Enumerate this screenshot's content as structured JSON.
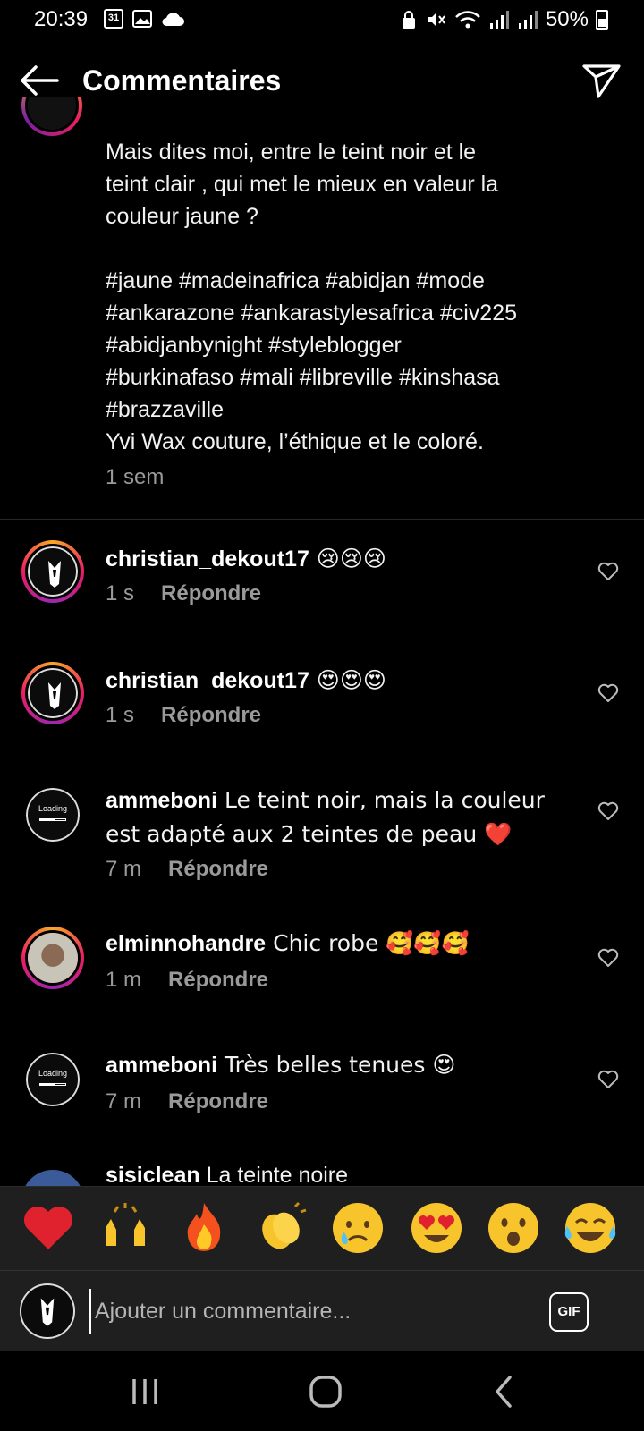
{
  "status_bar": {
    "time": "20:39",
    "calendar_day": "31",
    "battery": "50%",
    "battery_level": 0.5
  },
  "header": {
    "title": "Commentaires"
  },
  "caption": {
    "lines": [
      "Mais dites moi, entre le teint noir et le",
      "teint clair , qui met le mieux en valeur la",
      "couleur jaune ?",
      "",
      "#jaune #madeinafrica #abidjan #mode",
      "#ankarazone #ankarastylesafrica #civ225",
      "#abidjanbynight #styleblogger",
      "#burkinafaso #mali #libreville #kinshasa",
      "#brazzaville",
      "Yvi Wax couture, l’éthique et le coloré."
    ],
    "time": "1 sem"
  },
  "comments": [
    {
      "username": "christian_dekout17",
      "text": " 😢😢😢",
      "time": "1 s",
      "reply": "Répondre"
    },
    {
      "username": "christian_dekout17",
      "text": " 😍😍😍",
      "time": "1 s",
      "reply": "Répondre"
    },
    {
      "username": "ammeboni",
      "text": " Le teint noir, mais la couleur est adapté aux 2 teintes de peau ❤️",
      "time": "7 m",
      "reply": "Répondre",
      "avatar_text": "Loading"
    },
    {
      "username": "elminnohandre",
      "text": " Chic robe 🥰🥰🥰",
      "time": "1 m",
      "reply": "Répondre"
    },
    {
      "username": "ammeboni",
      "text": " Très belles tenues 😍",
      "time": "7 m",
      "reply": "Répondre",
      "avatar_text": "Loading"
    },
    {
      "username": "sisiclean",
      "text": " La teinte noire"
    }
  ],
  "emoji_tray": [
    "❤️",
    "🙌",
    "🔥",
    "👏",
    "😢",
    "😍",
    "😮",
    "😂"
  ],
  "input": {
    "placeholder": "Ajouter un commentaire...",
    "gif_label": "GIF"
  },
  "colors": {
    "background": "#000000",
    "tray": "#1f1f1f",
    "secondary_text": "#9a9a9a"
  }
}
